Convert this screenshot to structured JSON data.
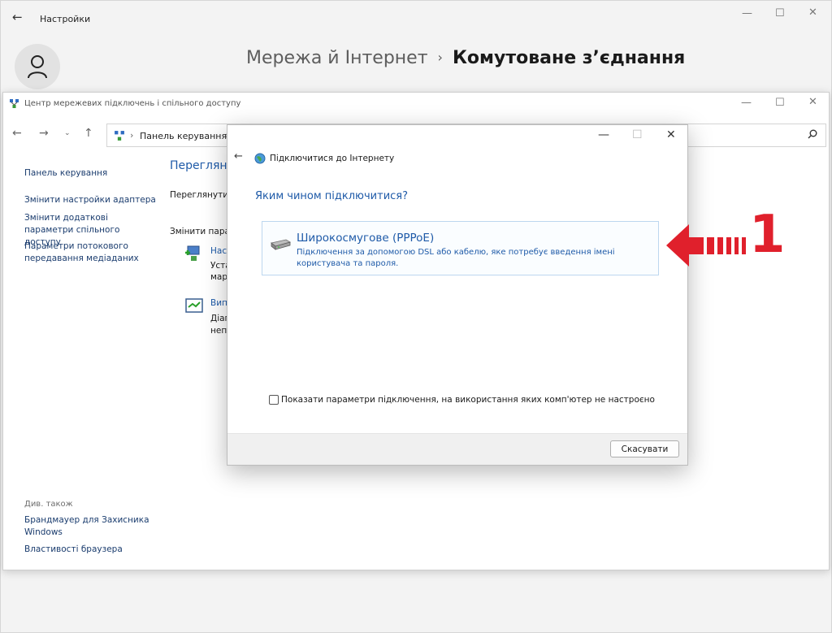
{
  "settings": {
    "app_title": "Настройки",
    "breadcrumb_parent": "Мережа й Інтернет",
    "breadcrumb_sep": "›",
    "breadcrumb_current": "Комутоване з’єднання"
  },
  "control_panel": {
    "title": "Центр мережевих підключень і спільного доступу",
    "address": "Панель керування",
    "addr_sep1": "›",
    "addr_sep2": "›",
    "sidebar": {
      "home": "Панель керування",
      "adapter": "Змінити настройки адаптера",
      "sharing": "Змінити додаткові параметри спільного доступу",
      "streaming": "Параметри потокового передавання медіаданих",
      "see_also": "Див. також",
      "firewall": "Брандмауер для Захисника Windows",
      "browser": "Властивості браузера"
    },
    "main": {
      "heading": "Переглянут",
      "view_text": "Переглянути",
      "change_text": "Змінити пара",
      "link1": "Нас",
      "text1a": "Уста",
      "text1b": "мар",
      "link2": "Вип",
      "text2a": "Діаг",
      "text2b": "неп"
    }
  },
  "dialog": {
    "title": "Підключитися до Інтернету",
    "question": "Яким чином підключитися?",
    "option": {
      "title": "Широкосмугове (PPPoE)",
      "description": "Підключення за допомогою DSL або кабелю, яке потребує введення імені користувача та пароля."
    },
    "checkbox_label": "Показати параметри підключення, на використання яких комп'ютер не настроєно",
    "checkbox_checked": false,
    "cancel_label": "Скасувати"
  },
  "annotation": {
    "number": "1",
    "color": "#e0202c"
  },
  "icons": {
    "back": "arrow-left-icon",
    "minimize": "minimize-icon",
    "maximize": "maximize-icon",
    "close": "close-icon",
    "user": "user-icon",
    "search": "search-icon",
    "globe": "globe-icon",
    "modem": "modem-icon"
  }
}
